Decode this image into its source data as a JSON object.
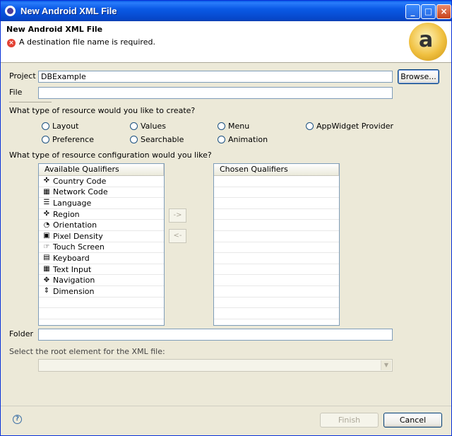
{
  "window": {
    "title": "New Android XML File"
  },
  "header": {
    "title": "New Android XML File",
    "error": "A destination file name is required.",
    "logo_text": "a"
  },
  "project": {
    "label": "Project",
    "value": "DBExample",
    "browse_label": "Browse..."
  },
  "file": {
    "label": "File",
    "value": ""
  },
  "resource_type": {
    "question": "What type of resource would you like to create?",
    "options": [
      "Layout",
      "Values",
      "Menu",
      "AppWidget Provider",
      "Preference",
      "Searchable",
      "Animation"
    ]
  },
  "config": {
    "question": "What type of resource configuration would you like?",
    "available_header": "Available Qualifiers",
    "chosen_header": "Chosen Qualifiers",
    "qualifiers": [
      {
        "label": "Country Code",
        "icon": "country-code-icon"
      },
      {
        "label": "Network Code",
        "icon": "network-code-icon"
      },
      {
        "label": "Language",
        "icon": "language-icon"
      },
      {
        "label": "Region",
        "icon": "region-icon"
      },
      {
        "label": "Orientation",
        "icon": "orientation-icon"
      },
      {
        "label": "Pixel Density",
        "icon": "pixel-density-icon"
      },
      {
        "label": "Touch Screen",
        "icon": "touch-screen-icon"
      },
      {
        "label": "Keyboard",
        "icon": "keyboard-icon"
      },
      {
        "label": "Text Input",
        "icon": "text-input-icon"
      },
      {
        "label": "Navigation",
        "icon": "navigation-icon"
      },
      {
        "label": "Dimension",
        "icon": "dimension-icon"
      }
    ],
    "add_label": "->",
    "remove_label": "<-"
  },
  "folder": {
    "label": "Folder",
    "value": ""
  },
  "root_element": {
    "label": "Select the root element for the XML file:",
    "value": ""
  },
  "footer": {
    "finish_label": "Finish",
    "cancel_label": "Cancel"
  }
}
